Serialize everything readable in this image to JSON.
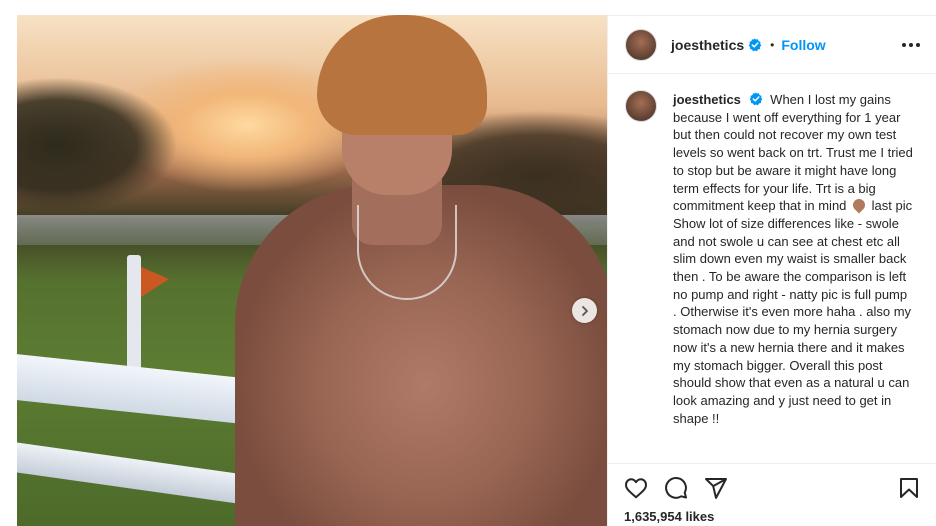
{
  "post": {
    "username": "joesthetics",
    "separator": "•",
    "follow_label": "Follow",
    "caption_username": "joesthetics",
    "caption_before_emoji": "When I lost my gains because I went off everything for 1 year but then could not recover my own test levels so went back on trt. Trust me I tried to stop but be aware it might have long term effects for your life. Trt is a big commitment keep that in mind",
    "caption_emoji": "brown-heart",
    "caption_after_emoji": "last pic Show lot of size differences like - swole and not swole u can see at chest etc all slim down even my waist is smaller back then . To be aware the comparison is left no pump and right - natty pic is full pump . Otherwise it's even more haha . also my stomach now due to my hernia surgery now it's a new hernia there and it makes my stomach bigger. Overall this post should show that even as a natural u can look amazing and y just need to get in shape !!",
    "likes": "1,635,954 likes"
  },
  "icons": {
    "verified": "verified-badge-icon",
    "more": "more-options-icon",
    "like": "heart-icon",
    "comment": "comment-icon",
    "share": "send-icon",
    "save": "bookmark-icon",
    "next": "chevron-right-icon"
  },
  "colors": {
    "accent": "#0095f6",
    "text": "#262626",
    "border": "#efefef"
  }
}
